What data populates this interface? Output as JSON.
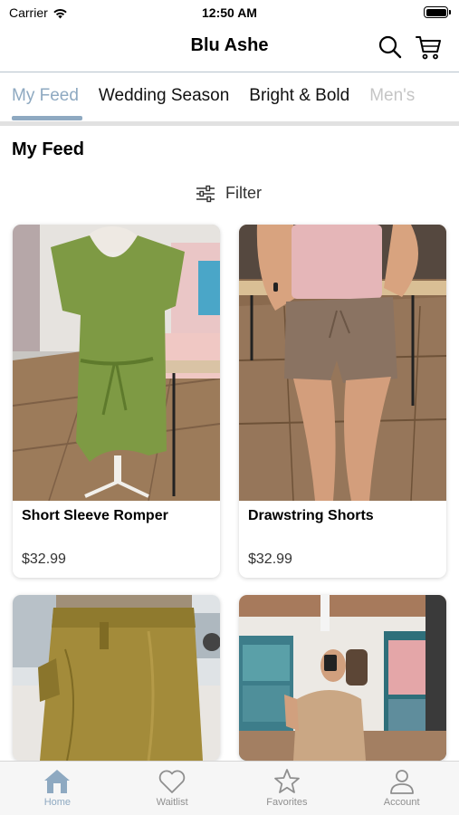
{
  "status_bar": {
    "carrier": "Carrier",
    "time": "12:50 AM"
  },
  "header": {
    "title": "Blu Ashe",
    "icons": [
      "search-icon",
      "cart-icon"
    ]
  },
  "tabs": [
    {
      "label": "My Feed",
      "state": "active"
    },
    {
      "label": "Wedding Season",
      "state": "normal"
    },
    {
      "label": "Bright & Bold",
      "state": "normal"
    },
    {
      "label": "Men's",
      "state": "faded"
    }
  ],
  "section_title": "My Feed",
  "filter": {
    "label": "Filter",
    "icon": "sliders-icon"
  },
  "products": [
    {
      "name": "Short Sleeve Romper",
      "price": "$32.99",
      "image_desc": "green-romper"
    },
    {
      "name": "Drawstring Shorts",
      "price": "$32.99",
      "image_desc": "taupe-shorts"
    },
    {
      "name": "",
      "price": "",
      "image_desc": "mustard-skirt"
    },
    {
      "name": "",
      "price": "",
      "image_desc": "tan-top-mirror-selfie"
    }
  ],
  "bottom_nav": [
    {
      "label": "Home",
      "icon": "home-icon",
      "state": "active"
    },
    {
      "label": "Waitlist",
      "icon": "heart-icon",
      "state": "normal"
    },
    {
      "label": "Favorites",
      "icon": "star-icon",
      "state": "normal"
    },
    {
      "label": "Account",
      "icon": "person-icon",
      "state": "normal"
    }
  ],
  "colors": {
    "accent": "#8ea9c1",
    "inactive": "#8f8f8f",
    "divider": "#e1e1e1"
  }
}
